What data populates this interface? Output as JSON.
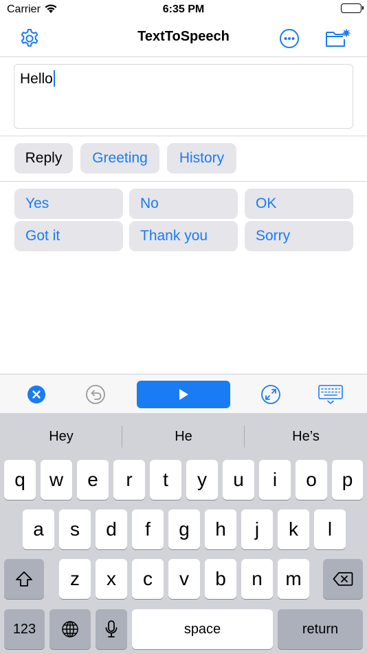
{
  "status": {
    "carrier": "Carrier",
    "time": "6:35 PM"
  },
  "nav": {
    "title": "TextToSpeech"
  },
  "input": {
    "value": "Hello"
  },
  "tabs": [
    {
      "label": "Reply",
      "active": true
    },
    {
      "label": "Greeting",
      "active": false
    },
    {
      "label": "History",
      "active": false
    }
  ],
  "phrases": [
    "Yes",
    "No",
    "OK",
    "Got it",
    "Thank you",
    "Sorry"
  ],
  "toolbar": {
    "icons": [
      "clear-icon",
      "undo-icon",
      "play-icon",
      "expand-icon",
      "keyboard-hide-icon"
    ]
  },
  "keyboard": {
    "suggestions": [
      "Hey",
      "He",
      "He’s"
    ],
    "row1": [
      "q",
      "w",
      "e",
      "r",
      "t",
      "y",
      "u",
      "i",
      "o",
      "p"
    ],
    "row2": [
      "a",
      "s",
      "d",
      "f",
      "g",
      "h",
      "j",
      "k",
      "l"
    ],
    "row3": [
      "z",
      "x",
      "c",
      "v",
      "b",
      "n",
      "m"
    ],
    "numbers_label": "123",
    "space_label": "space",
    "return_label": "return"
  },
  "colors": {
    "accent": "#1a7cf3",
    "button_bg": "#e5e5ea",
    "keyboard_bg": "#d1d3d9"
  }
}
